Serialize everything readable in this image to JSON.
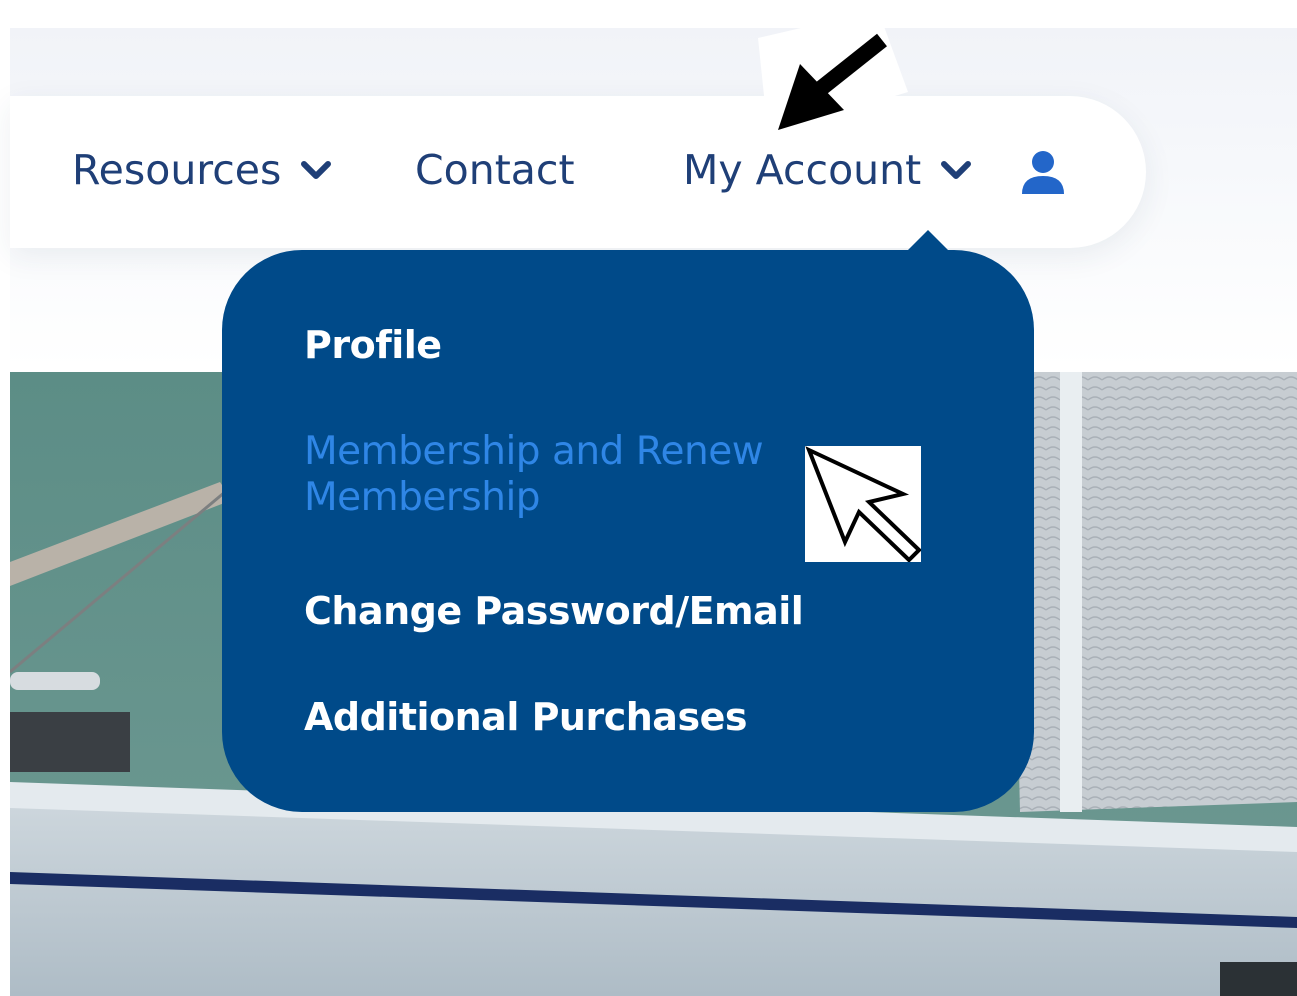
{
  "nav": {
    "items": [
      {
        "label": "Resources",
        "has_dropdown": true
      },
      {
        "label": "Contact",
        "has_dropdown": false
      },
      {
        "label": "My Account",
        "has_dropdown": true
      }
    ],
    "account_icon": "user-icon",
    "chevron_icon": "chevron-down-icon"
  },
  "account_menu": {
    "items": [
      {
        "label": "Profile",
        "state": "default"
      },
      {
        "label": "Membership and Renew Membership",
        "state": "hover"
      },
      {
        "label": "Change Password/Email",
        "state": "default"
      },
      {
        "label": "Additional Purchases",
        "state": "default"
      }
    ]
  },
  "colors": {
    "nav_text": "#1f3f77",
    "dropdown_bg": "#004a89",
    "menu_text": "#ffffff",
    "menu_hover_text": "#2f86e6"
  },
  "annotations": {
    "arrow_icon": "annotation-arrow-icon",
    "cursor_icon": "mouse-cursor-icon"
  }
}
